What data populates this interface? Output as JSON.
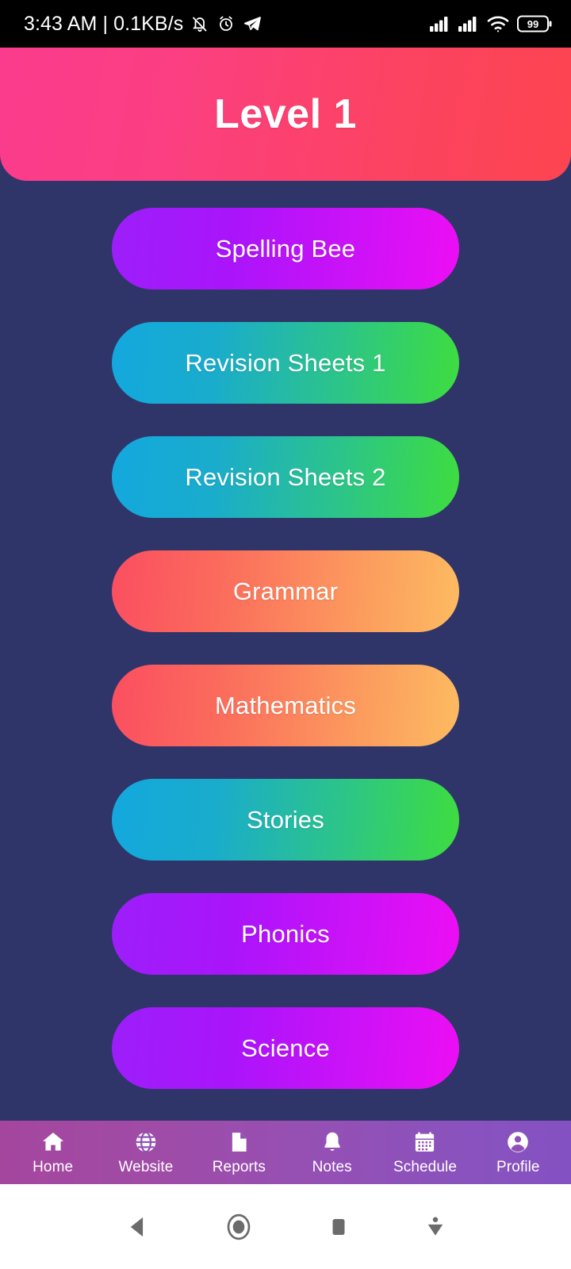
{
  "status_bar": {
    "time_and_net": "3:43 AM | 0.1KB/s",
    "battery_level": "99",
    "icons": [
      "bell-off-icon",
      "alarm-icon",
      "telegram-icon",
      "signal-bars-icon",
      "signal-bars-icon",
      "wifi-icon",
      "battery-icon"
    ],
    "background": "#000000"
  },
  "header": {
    "title": "Level 1",
    "gradient_start": "#fb3b8d",
    "gradient_end": "#fd4450"
  },
  "page": {
    "background": "#2f3568"
  },
  "tiles": [
    {
      "label": "Spelling Bee",
      "style": "g-purple",
      "start": "#9c1ffa",
      "end": "#ed0ef4"
    },
    {
      "label": "Revision Sheets 1",
      "style": "g-green",
      "start": "#13a8de",
      "end": "#3edd3f"
    },
    {
      "label": "Revision Sheets 2",
      "style": "g-green",
      "start": "#13a8de",
      "end": "#3edd3f"
    },
    {
      "label": "Grammar",
      "style": "g-orange",
      "start": "#fb4e61",
      "end": "#fdbb61"
    },
    {
      "label": "Mathematics",
      "style": "g-orange",
      "start": "#fb4e61",
      "end": "#fdbb61"
    },
    {
      "label": "Stories",
      "style": "g-green",
      "start": "#13a8de",
      "end": "#3edd3f"
    },
    {
      "label": "Phonics",
      "style": "g-purple",
      "start": "#9c1ffa",
      "end": "#ed0ef4"
    },
    {
      "label": "Science",
      "style": "g-purple",
      "start": "#9c1ffa",
      "end": "#ed0ef4"
    }
  ],
  "bottom_nav": {
    "gradient_start": "#a5469e",
    "gradient_end": "#8451c2",
    "items": [
      {
        "label": "Home",
        "icon": "home-icon"
      },
      {
        "label": "Website",
        "icon": "globe-icon"
      },
      {
        "label": "Reports",
        "icon": "document-icon"
      },
      {
        "label": "Notes",
        "icon": "bell-icon"
      },
      {
        "label": "Schedule",
        "icon": "calendar-icon"
      },
      {
        "label": "Profile",
        "icon": "account-circle-icon"
      }
    ]
  },
  "system_nav": {
    "background": "#ffffff",
    "buttons": [
      "back-triangle-icon",
      "home-circle-icon",
      "recents-square-icon",
      "download-arrow-icon"
    ]
  }
}
